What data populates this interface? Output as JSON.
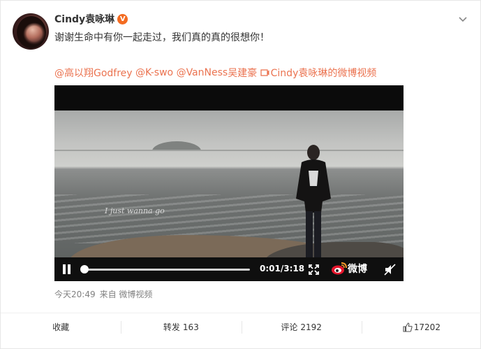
{
  "user": {
    "name": "Cindy袁咏琳",
    "verified_badge": "V",
    "badge_color": "#f36b21"
  },
  "post": {
    "text": "谢谢生命中有你一起走过，我们真的真的很想你！",
    "mentions": [
      "@高以翔Godfrey",
      "@K-swo",
      "@VanNess"
    ],
    "link_text": "吴建豪",
    "video_link_text": "Cindy袁咏琳的微博视频",
    "accent_color": "#eb7350"
  },
  "video": {
    "subtitle": "I just wanna go",
    "time": "0:01/3:18",
    "progress": 0.005,
    "brand": "微博",
    "icons": [
      "pause-icon",
      "fullscreen-icon",
      "weibo-logo-icon",
      "mute-icon"
    ]
  },
  "meta": {
    "timestamp": "今天20:49",
    "source": "来自 微博视频"
  },
  "actions": [
    {
      "label": "收藏",
      "count": ""
    },
    {
      "label": "转发",
      "count": "163"
    },
    {
      "label": "评论",
      "count": "2192"
    },
    {
      "label": "",
      "count": "17202",
      "icon": "thumbs-up-icon"
    }
  ]
}
